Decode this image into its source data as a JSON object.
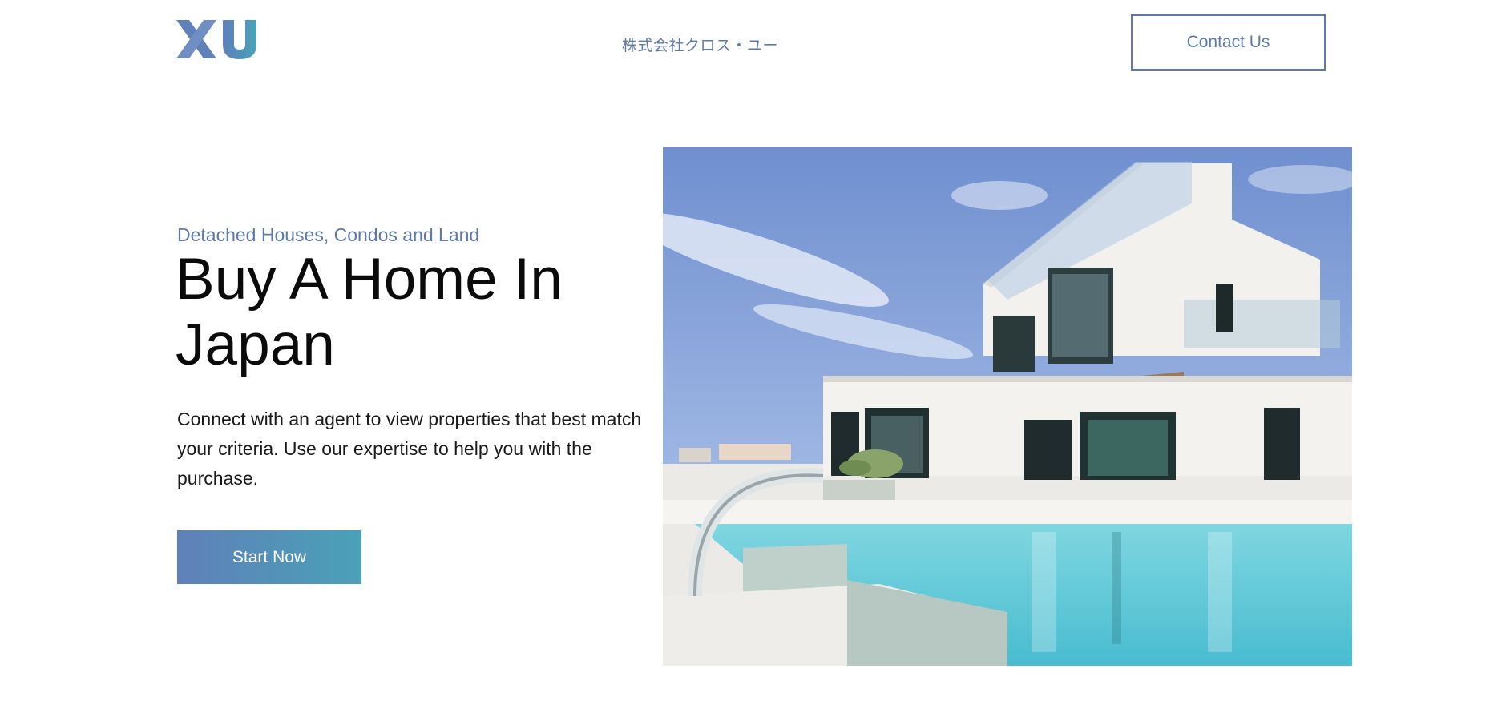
{
  "header": {
    "logo_text": "XU",
    "company_name": "株式会社クロス・ユー",
    "contact_label": "Contact Us"
  },
  "hero": {
    "subtitle": "Detached Houses, Condos and Land",
    "title": "Buy A Home In Japan",
    "description": "Connect with an agent to view properties that best match your criteria. Use our expertise to help you with the purchase.",
    "cta_label": "Start Now"
  },
  "colors": {
    "accent": "#5e79a8",
    "gradient_start": "#5f80b9",
    "gradient_end": "#4aa1b8",
    "text_dark": "#0b0b0b"
  }
}
